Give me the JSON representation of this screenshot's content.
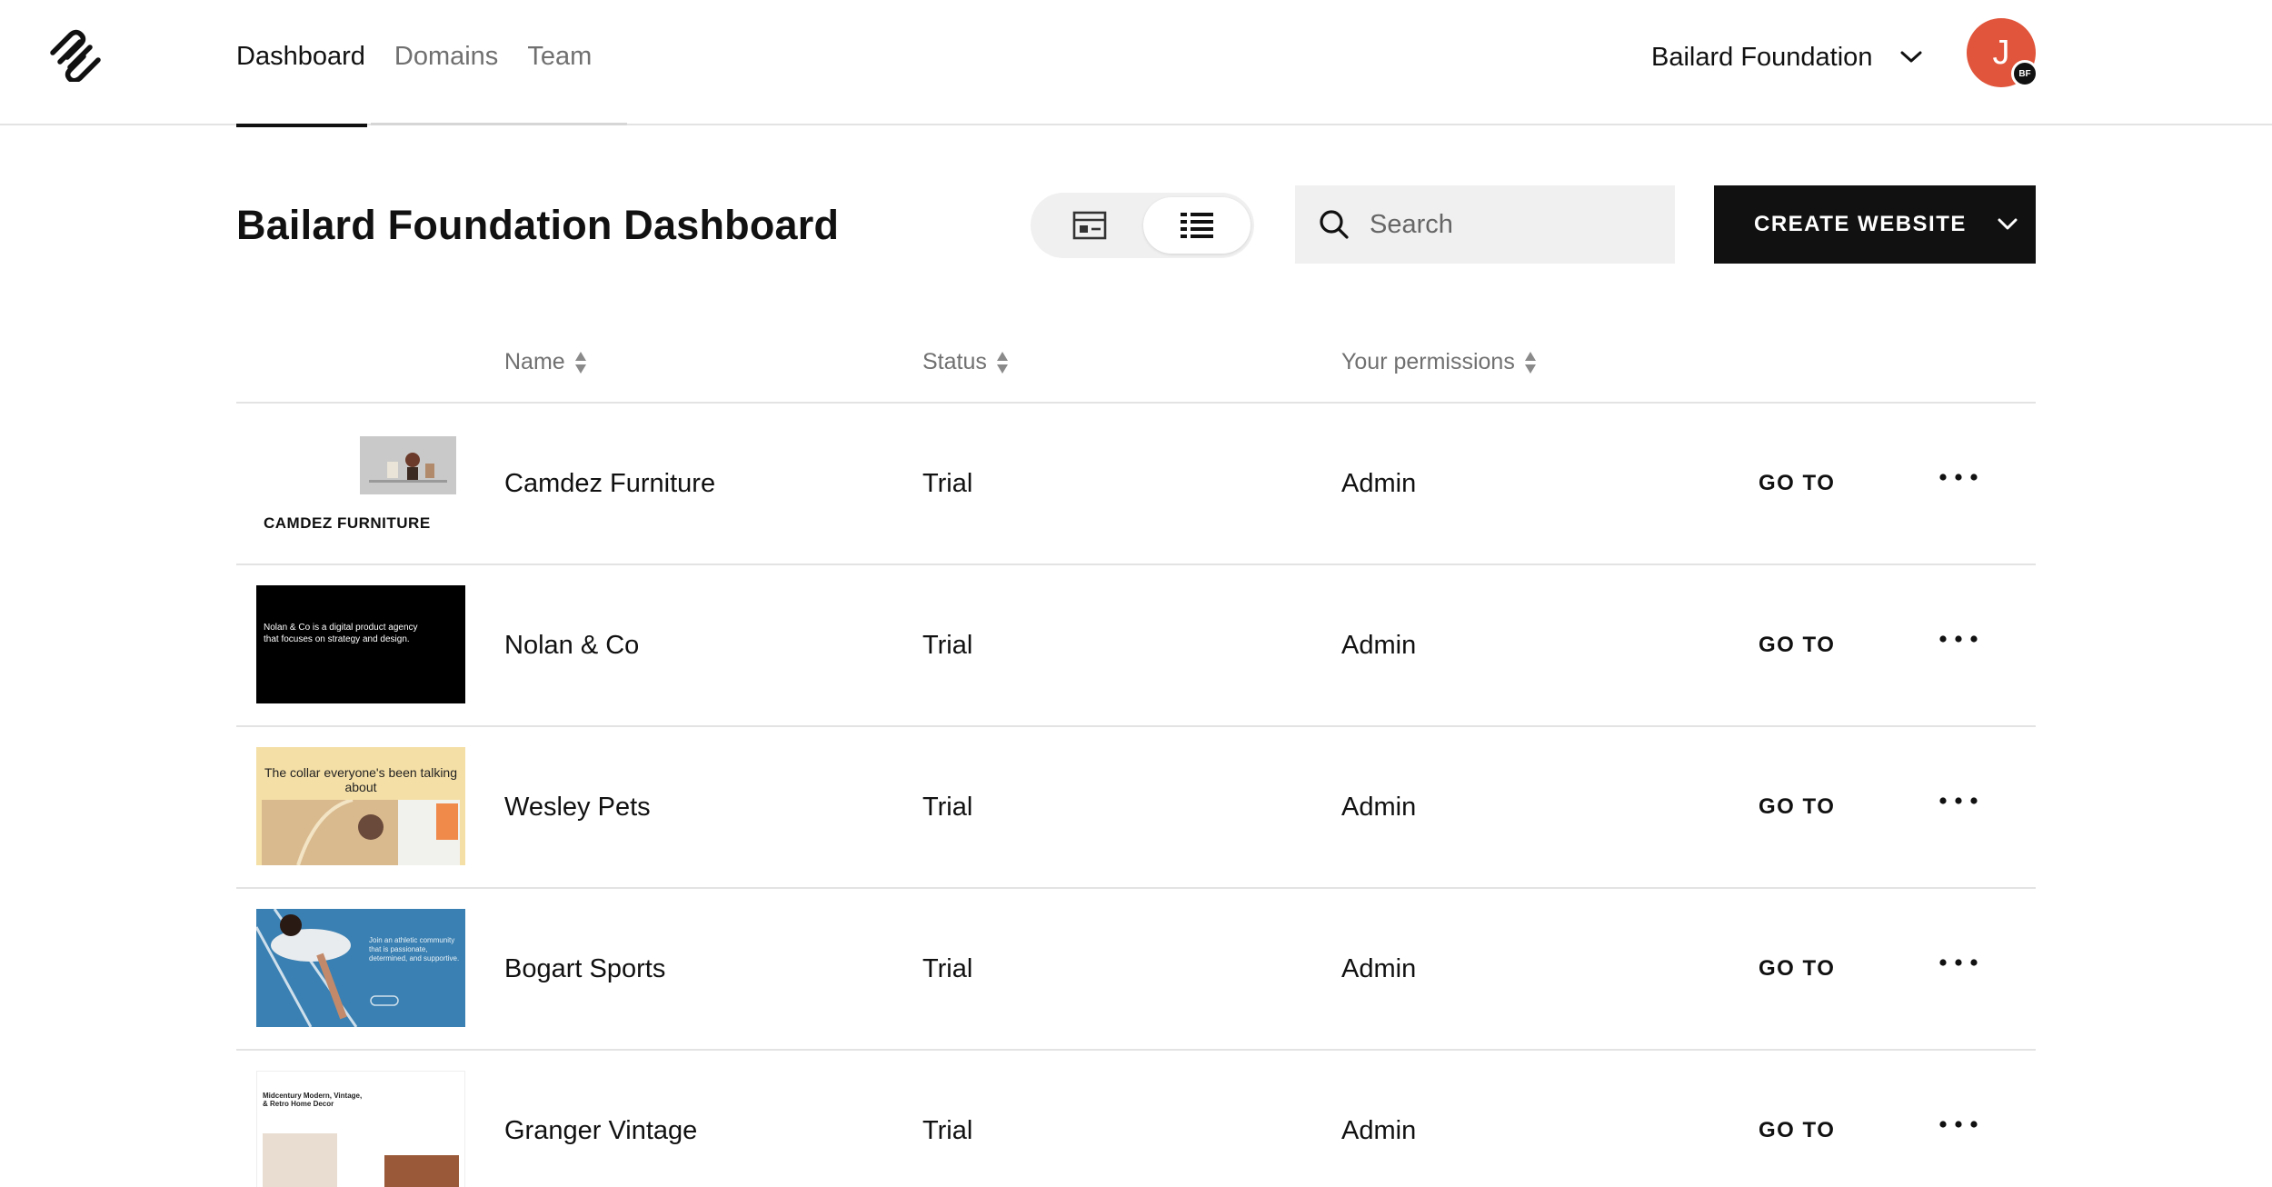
{
  "nav": {
    "tabs": [
      {
        "label": "Dashboard",
        "active": true
      },
      {
        "label": "Domains",
        "active": false
      },
      {
        "label": "Team",
        "active": false
      }
    ],
    "org_name": "Bailard Foundation",
    "avatar_initial": "J",
    "avatar_badge": "BF"
  },
  "header": {
    "title": "Bailard Foundation Dashboard",
    "search_placeholder": "Search",
    "create_label": "CREATE WEBSITE",
    "active_view": "list"
  },
  "table": {
    "columns": {
      "name": "Name",
      "status": "Status",
      "permissions": "Your permissions"
    },
    "goto_label": "GO TO",
    "rows": [
      {
        "name": "Camdez Furniture",
        "status": "Trial",
        "permissions": "Admin"
      },
      {
        "name": "Nolan & Co",
        "status": "Trial",
        "permissions": "Admin"
      },
      {
        "name": "Wesley Pets",
        "status": "Trial",
        "permissions": "Admin"
      },
      {
        "name": "Bogart Sports",
        "status": "Trial",
        "permissions": "Admin"
      },
      {
        "name": "Granger Vintage",
        "status": "Trial",
        "permissions": "Admin"
      }
    ]
  },
  "thumbnails": {
    "camdez": {
      "headline": "CAMDEZ FURNITURE"
    },
    "nolan": {
      "text": "Nolan & Co is a digital product agency that focuses on strategy and design."
    },
    "wesley": {
      "text": "The collar everyone's been talking about"
    },
    "bogart": {
      "text": "Join an athletic community that is passionate, determined, and supportive."
    },
    "granger": {
      "text": "Midcentury Modern, Vintage, & Retro Home Decor"
    }
  },
  "colors": {
    "accent": "#111111",
    "avatar": "#e0553b",
    "muted_text": "#707070",
    "divider": "#e3e3e3",
    "surface": "#f0f0f0"
  },
  "icons": {
    "logo": "squarespace-logo-icon",
    "org_chevron": "chevron-down-icon",
    "grid_view": "grid-view-icon",
    "list_view": "list-view-icon",
    "search": "search-icon",
    "create_chevron": "chevron-down-icon",
    "sort": "sort-icon",
    "more": "more-horizontal-icon"
  }
}
